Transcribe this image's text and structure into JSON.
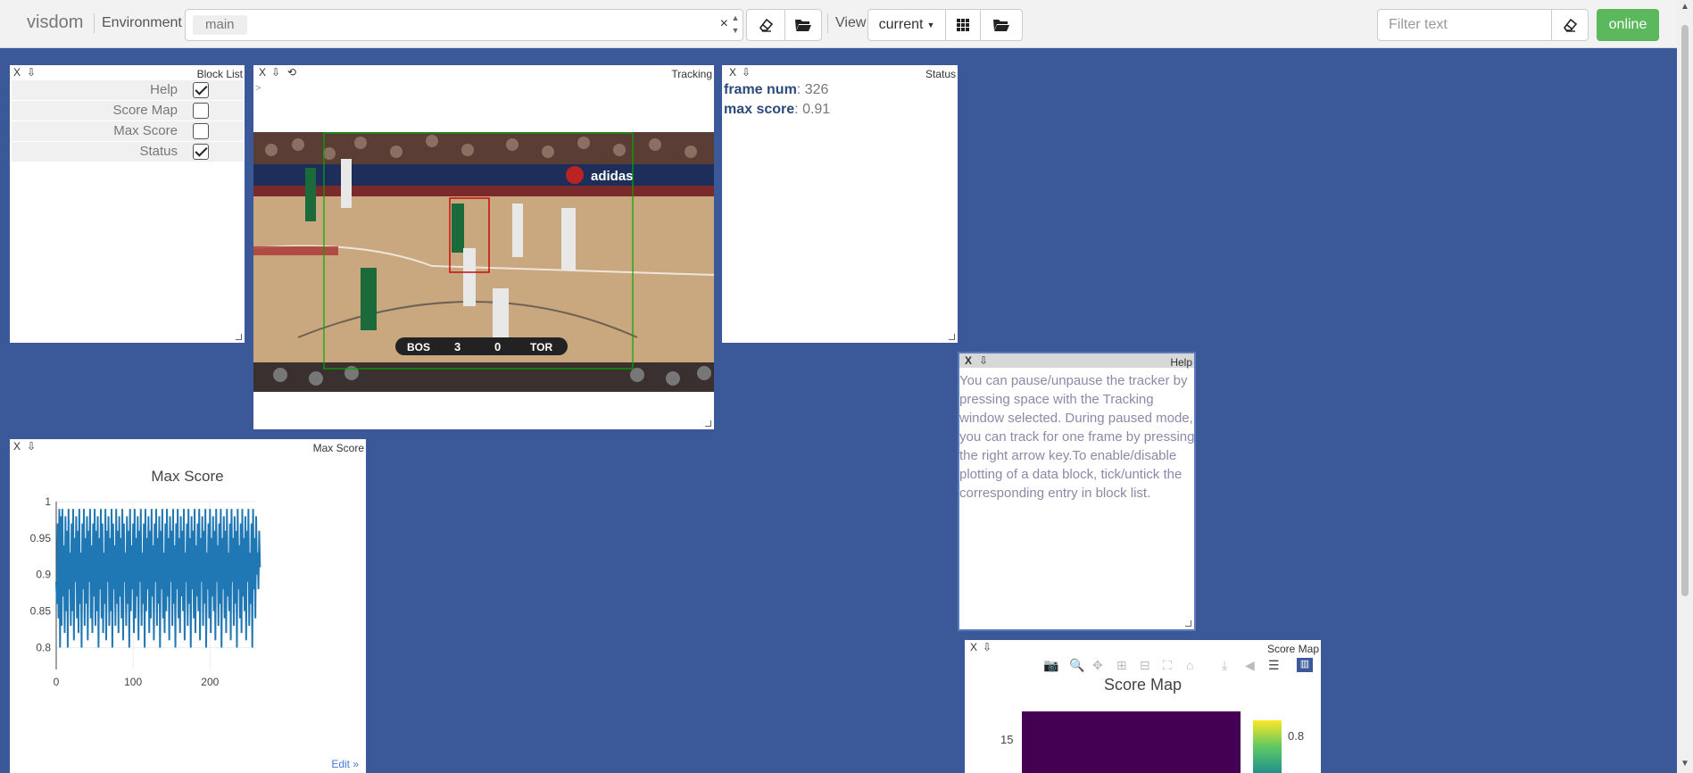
{
  "app": {
    "brand": "visdom",
    "environment_label": "Environment",
    "env_tag": "main",
    "env_clear": "×",
    "view_label": "View",
    "view_select": "current",
    "filter_placeholder": "Filter text",
    "online": "online"
  },
  "colors": {
    "background": "#3b5998",
    "online": "#5cb85c",
    "plot_line": "#1f77b4"
  },
  "icons": [
    "eraser-icon",
    "folder-open-icon",
    "grid-icon",
    "caret-down-icon",
    "close-icon",
    "download-icon",
    "refresh-icon",
    "camera-icon",
    "zoom-icon",
    "pan-icon",
    "zoom-in-icon",
    "zoom-out-icon",
    "autoscale-icon",
    "home-icon",
    "spike-icon",
    "hover-icon",
    "compare-icon",
    "plotly-logo-icon"
  ],
  "panes": {
    "block_list": {
      "title": "Block List",
      "close": "X",
      "dl": "⇩",
      "items": [
        {
          "label": "Help",
          "checked": true
        },
        {
          "label": "Score Map",
          "checked": false
        },
        {
          "label": "Max Score",
          "checked": false
        },
        {
          "label": "Status",
          "checked": true
        }
      ]
    },
    "tracking": {
      "title": "Tracking",
      "close": "X",
      "dl": "⇩",
      "refresh": "⟲",
      "caret": ">",
      "scoreboard": {
        "home": "BOS",
        "home_score": "3",
        "away": "TOR",
        "away_score": "0",
        "banner": "adidas"
      }
    },
    "status": {
      "title": "Status",
      "close": "X",
      "dl": "⇩",
      "frame_label": "frame num",
      "frame_value": "326",
      "score_label": "max score",
      "score_value": "0.91"
    },
    "help": {
      "title": "Help",
      "close": "X",
      "dl": "⇩",
      "text": "You can pause/unpause the tracker by pressing space with the Tracking window selected. During paused mode, you can track for one frame by pressing the right arrow key.To enable/disable plotting of a data block, tick/untick the corresponding entry in block list."
    },
    "max_score": {
      "title": "Max Score",
      "close": "X",
      "dl": "⇩",
      "edit": "Edit »"
    },
    "score_map": {
      "title": "Score Map",
      "close": "X",
      "dl": "⇩",
      "plot_title": "Score Map",
      "ytick": "15",
      "colorbar_tick": "0.8"
    }
  },
  "chart_data": {
    "type": "line",
    "title": "Max Score",
    "xlabel": "",
    "ylabel": "",
    "xlim": [
      0,
      260
    ],
    "ylim": [
      0.77,
      1.0
    ],
    "xticks": [
      0,
      100,
      200
    ],
    "yticks": [
      0.8,
      0.85,
      0.9,
      0.95,
      1
    ],
    "ytick_labels": [
      "0.8",
      "0.85",
      "0.9",
      "0.95",
      "1"
    ],
    "series": [
      {
        "values": [
          0.89,
          0.86,
          0.97,
          0.84,
          0.99,
          0.8,
          0.98,
          0.83,
          0.99,
          0.87,
          0.94,
          0.82,
          0.98,
          0.85,
          0.96,
          0.8,
          0.99,
          0.88,
          0.93,
          0.83,
          0.97,
          0.85,
          0.99,
          0.81,
          0.95,
          0.89,
          0.98,
          0.84,
          0.96,
          0.82,
          0.99,
          0.86,
          0.93,
          0.8,
          0.97,
          0.88,
          0.99,
          0.83,
          0.95,
          0.86,
          0.98,
          0.81,
          0.96,
          0.89,
          0.99,
          0.84,
          0.94,
          0.82,
          0.97,
          0.87,
          0.99,
          0.83,
          0.96,
          0.85,
          0.98,
          0.8,
          0.95,
          0.88,
          0.99,
          0.84,
          0.97,
          0.82,
          0.93,
          0.86,
          0.99,
          0.81,
          0.96,
          0.89,
          0.98,
          0.83,
          0.95,
          0.85,
          0.99,
          0.8,
          0.97,
          0.88,
          0.94,
          0.83,
          0.99,
          0.86,
          0.96,
          0.82,
          0.98,
          0.87,
          0.95,
          0.84,
          0.99,
          0.81,
          0.97,
          0.89,
          0.93,
          0.83,
          0.98,
          0.86,
          0.96,
          0.8,
          0.99,
          0.85,
          0.94,
          0.88,
          0.97,
          0.82,
          0.99,
          0.84,
          0.95,
          0.87,
          0.98,
          0.81,
          0.96,
          0.89,
          0.99,
          0.83,
          0.93,
          0.86,
          0.97,
          0.8,
          0.99,
          0.85,
          0.95,
          0.88,
          0.98,
          0.82,
          0.96,
          0.84,
          0.99,
          0.87,
          0.94,
          0.81,
          0.97,
          0.89,
          0.99,
          0.83,
          0.95,
          0.86,
          0.98,
          0.8,
          0.96,
          0.88,
          0.99,
          0.84,
          0.93,
          0.82,
          0.97,
          0.85,
          0.99,
          0.87,
          0.95,
          0.81,
          0.98,
          0.89,
          0.96,
          0.83,
          0.99,
          0.86,
          0.94,
          0.8,
          0.97,
          0.88,
          0.99,
          0.84,
          0.95,
          0.82,
          0.98,
          0.87,
          0.96,
          0.85,
          0.99,
          0.81,
          0.93,
          0.89,
          0.97,
          0.83,
          0.99,
          0.86,
          0.95,
          0.8,
          0.98,
          0.88,
          0.96,
          0.84,
          0.99,
          0.82,
          0.94,
          0.87,
          0.97,
          0.85,
          0.99,
          0.81,
          0.95,
          0.89,
          0.98,
          0.83,
          0.96,
          0.86,
          0.99,
          0.8,
          0.93,
          0.88,
          0.97,
          0.84,
          0.99,
          0.82,
          0.95,
          0.87,
          0.98,
          0.85,
          0.96,
          0.81,
          0.99,
          0.89,
          0.94,
          0.83,
          0.97,
          0.86,
          0.99,
          0.8,
          0.95,
          0.88,
          0.98,
          0.84,
          0.96,
          0.82,
          0.99,
          0.87,
          0.93,
          0.85,
          0.97,
          0.81,
          0.99,
          0.89,
          0.95,
          0.83,
          0.98,
          0.86,
          0.96,
          0.8,
          0.99,
          0.88,
          0.94,
          0.84,
          0.97,
          0.82,
          0.99,
          0.87,
          0.95,
          0.85,
          0.98,
          0.81,
          0.96,
          0.89,
          0.99,
          0.83,
          0.93,
          0.86,
          0.97,
          0.8,
          0.99,
          0.88,
          0.95,
          0.84,
          0.98,
          0.9,
          0.93,
          0.88,
          0.96,
          0.91
        ]
      }
    ]
  }
}
